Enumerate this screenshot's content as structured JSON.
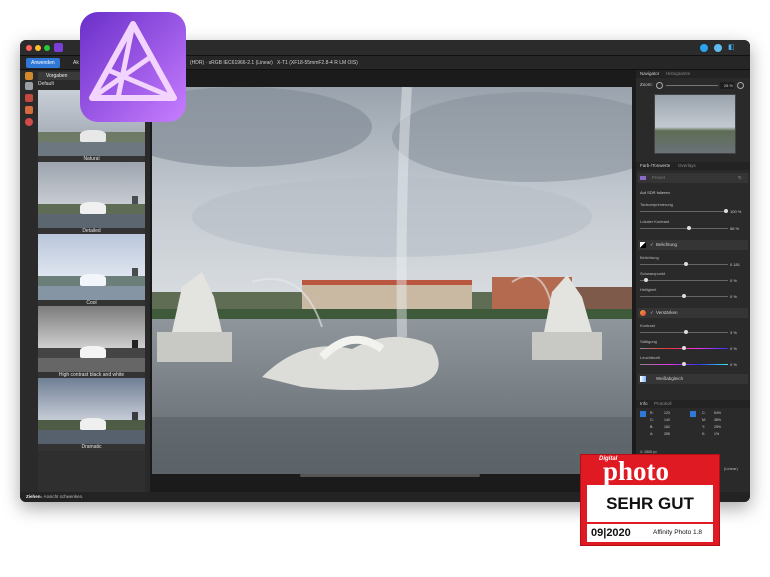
{
  "window": {
    "traffic_lights": [
      "#ff5f57",
      "#febc2e",
      "#28c840"
    ],
    "title": "(HDR) · sRGB IEC61966-2.1 (Linear)   X-T1 (XF18-55mmF2.8-4 R LM OIS)"
  },
  "toolbar": {
    "apply_label": "Anwenden",
    "partial_label": "Ak"
  },
  "left_panel": {
    "tab_label": "Vorgaben",
    "group_label": "Default",
    "presets": [
      {
        "label": "Natural"
      },
      {
        "label": "Detailed"
      },
      {
        "label": "Cool"
      },
      {
        "label": "High contrast black and white"
      },
      {
        "label": "Dramatic"
      }
    ]
  },
  "right_panel": {
    "navigator": {
      "tab_active": "Navigator",
      "tab_inactive": "Histogramm",
      "zoom_label": "Zoom:",
      "zoom_value": "28 %"
    },
    "tonemap": {
      "tab_active": "Farb-/Tonwerte",
      "tab_inactive": "Overlays",
      "preset_label": "Preset",
      "checkbox_label": "Auf SDR folieren",
      "rows": [
        {
          "label": "Tonkomprimierung",
          "value": "100 %",
          "fraction": 1.0
        },
        {
          "label": "Lokaler Kontrast",
          "value": "56 %",
          "fraction": 0.56
        }
      ]
    },
    "exposure": {
      "title": "Belichtung",
      "rows": [
        {
          "label": "Belichtung",
          "value": "0.181",
          "fraction": 0.52
        },
        {
          "label": "Schwarzpunkt",
          "value": "0 %",
          "fraction": 0.05
        },
        {
          "label": "Helligkeit",
          "value": "0 %",
          "fraction": 0.5
        }
      ]
    },
    "enhance": {
      "title": "Verstärken",
      "rows": [
        {
          "label": "Kontrast",
          "value": "3 %",
          "fraction": 0.52
        },
        {
          "label": "Sättigung",
          "value": "0 %",
          "fraction": 0.5
        },
        {
          "label": "Leuchtkraft",
          "value": "0 %",
          "fraction": 0.5
        }
      ]
    },
    "whitebalance": {
      "title": "Weißabgleich"
    },
    "info": {
      "tab_active": "Info",
      "tab_inactive": "Protokoll",
      "rgb": {
        "r": "123",
        "g": "140",
        "b": "162",
        "a": "255"
      },
      "cmyk": {
        "c": "54%",
        "m": "38%",
        "y": "25%",
        "k": "1%"
      },
      "coords": "X: 2868 px"
    },
    "footer_text": "(Linear)"
  },
  "status_bar": {
    "bold": "Ziehen",
    "text": " = Ansicht schwenken."
  },
  "badge": {
    "top": "Digital",
    "brand": "photo",
    "rating": "SEHR GUT",
    "issue": "09|2020",
    "product": "Affinity Photo 1.8"
  },
  "logo": {
    "colors": [
      "#7a3fd6",
      "#c27bff"
    ]
  }
}
